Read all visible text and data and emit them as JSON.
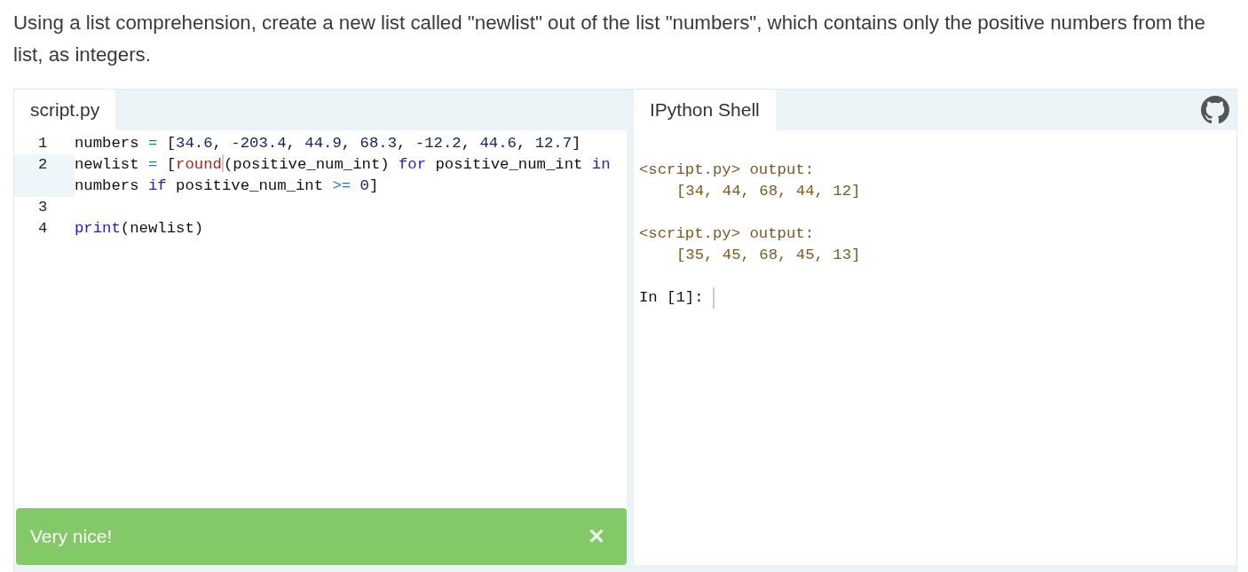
{
  "instruction": "Using a list comprehension, create a new list called \"newlist\" out of the list \"numbers\", which contains only the positive numbers from the list, as integers.",
  "editor": {
    "tab": {
      "label": "script.py",
      "selected": true
    },
    "lines": [
      {
        "number": "1",
        "active": false,
        "tokens": [
          {
            "kind": "plain",
            "text": "numbers "
          },
          {
            "kind": "operator",
            "text": "="
          },
          {
            "kind": "plain",
            "text": " ["
          },
          {
            "kind": "number",
            "text": "34.6"
          },
          {
            "kind": "plain",
            "text": ", "
          },
          {
            "kind": "number",
            "text": "-203.4"
          },
          {
            "kind": "plain",
            "text": ", "
          },
          {
            "kind": "number",
            "text": "44.9"
          },
          {
            "kind": "plain",
            "text": ", "
          },
          {
            "kind": "number",
            "text": "68.3"
          },
          {
            "kind": "plain",
            "text": ", "
          },
          {
            "kind": "number",
            "text": "-12.2"
          },
          {
            "kind": "plain",
            "text": ", "
          },
          {
            "kind": "number",
            "text": "44.6"
          },
          {
            "kind": "plain",
            "text": ", "
          },
          {
            "kind": "number",
            "text": "12.7"
          },
          {
            "kind": "plain",
            "text": "]"
          }
        ]
      },
      {
        "number": "2",
        "active": true,
        "tokens": [
          {
            "kind": "plain",
            "text": "newlist "
          },
          {
            "kind": "operator",
            "text": "="
          },
          {
            "kind": "plain",
            "text": " ["
          },
          {
            "kind": "builtin",
            "text": "round"
          },
          {
            "kind": "cursor"
          },
          {
            "kind": "plain",
            "text": "(positive_num_int) "
          },
          {
            "kind": "keyword",
            "text": "for"
          },
          {
            "kind": "plain",
            "text": " positive_num_int "
          },
          {
            "kind": "keyword",
            "text": "in"
          },
          {
            "kind": "plain",
            "text": " numbers "
          },
          {
            "kind": "keyword",
            "text": "if"
          },
          {
            "kind": "plain",
            "text": " positive_num_int "
          },
          {
            "kind": "operator",
            "text": ">= "
          },
          {
            "kind": "number",
            "text": "0"
          },
          {
            "kind": "plain",
            "text": "]"
          }
        ]
      },
      {
        "number": "3",
        "active": false
      },
      {
        "number": "4",
        "active": false,
        "tokens": [
          {
            "kind": "keyword",
            "text": "print"
          },
          {
            "kind": "plain",
            "text": "(newlist)"
          }
        ]
      }
    ]
  },
  "shell": {
    "tab": {
      "label": "IPython Shell",
      "selected": true
    },
    "outputs": [
      {
        "header": "<script.py> output:",
        "result": "[34, 44, 68, 44, 12]"
      },
      {
        "header": "<script.py> output:",
        "result": "[35, 45, 68, 45, 13]"
      }
    ],
    "prompt": "In [1]:"
  },
  "feedback": {
    "message": "Very nice!",
    "close": "✕"
  }
}
